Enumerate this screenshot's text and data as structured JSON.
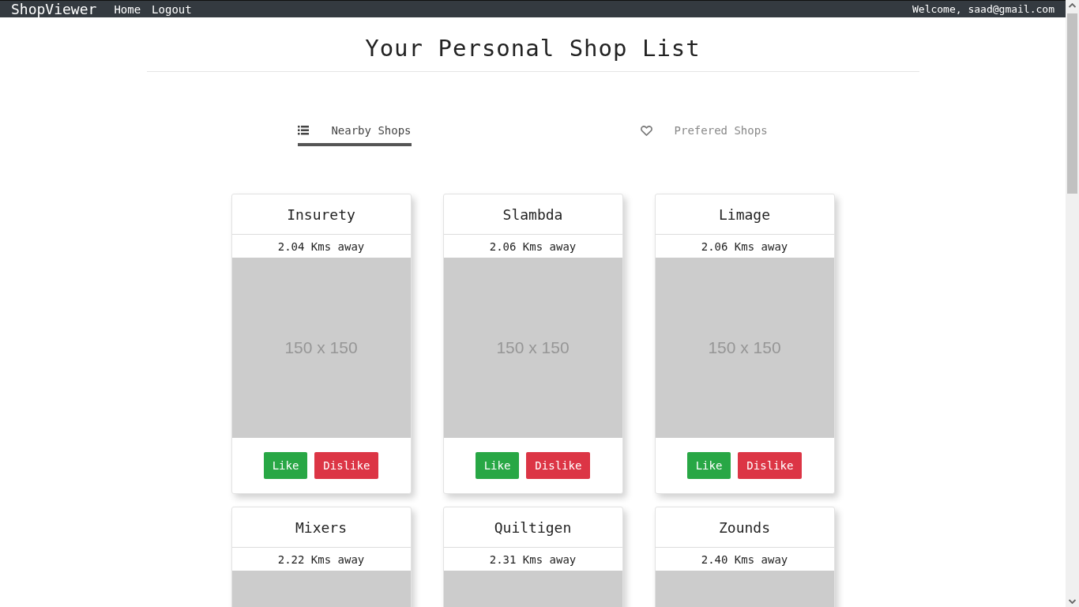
{
  "navbar": {
    "brand": "ShopViewer",
    "links": [
      "Home",
      "Logout"
    ],
    "welcome": "Welcome, saad@gmail.com"
  },
  "title": "Your Personal Shop List",
  "tabs": [
    {
      "label": "Nearby Shops",
      "selected": true
    },
    {
      "label": "Prefered Shops",
      "selected": false
    }
  ],
  "shops": [
    {
      "name": "Insurety",
      "distance": "2.04 Kms away",
      "image_label": "150 x 150",
      "buttons": [
        "Like",
        "Dislike"
      ]
    },
    {
      "name": "Slambda",
      "distance": "2.06 Kms away",
      "image_label": "150 x 150",
      "buttons": [
        "Like",
        "Dislike"
      ]
    },
    {
      "name": "Limage",
      "distance": "2.06 Kms away",
      "image_label": "150 x 150",
      "buttons": [
        "Like",
        "Dislike"
      ]
    },
    {
      "name": "Mixers",
      "distance": "2.22 Kms away"
    },
    {
      "name": "Quiltigen",
      "distance": "2.31 Kms away"
    },
    {
      "name": "Zounds",
      "distance": "2.40 Kms away"
    }
  ]
}
